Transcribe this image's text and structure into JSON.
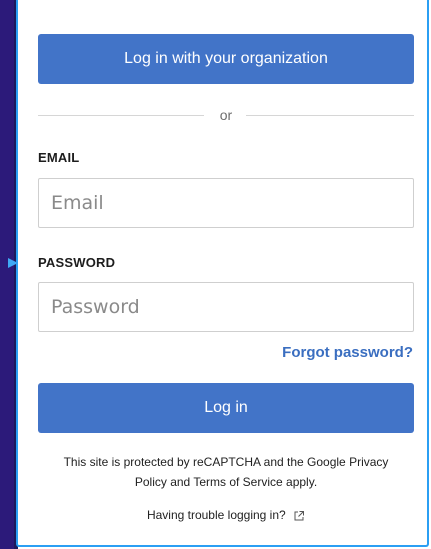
{
  "org_login": {
    "label": "Log in with your organization"
  },
  "divider": {
    "text": "or"
  },
  "email": {
    "label": "EMAIL",
    "placeholder": "Email",
    "value": ""
  },
  "password": {
    "label": "PASSWORD",
    "placeholder": "Password",
    "value": ""
  },
  "forgot_password": {
    "label": "Forgot password?"
  },
  "login": {
    "label": "Log in"
  },
  "recaptcha_notice": {
    "line1": "This site is protected by reCAPTCHA and the Google Privacy",
    "line2": "Policy and Terms of Service apply."
  },
  "trouble": {
    "label": "Having trouble logging in?",
    "icon": "external-link-icon"
  },
  "colors": {
    "button": "#4274c8",
    "link": "#3a6ec0",
    "card_border": "#2b9ff3",
    "background_left": "#1d1a5c"
  }
}
